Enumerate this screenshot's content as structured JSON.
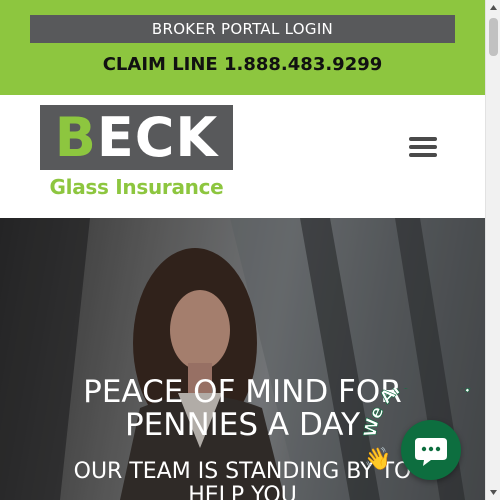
{
  "topbar": {
    "broker_login_label": "BROKER PORTAL LOGIN",
    "claim_line": "CLAIM LINE 1.888.483.9299"
  },
  "header": {
    "logo": {
      "letter_accent": "B",
      "letters_rest": "ECK",
      "subtitle": "Glass Insurance"
    },
    "menu_icon": "hamburger-menu-icon"
  },
  "hero": {
    "title_line1": "PEACE OF MIND FOR",
    "title_line2": "PENNIES A DAY",
    "subtitle_line1": "OUR TEAM IS STANDING BY TO",
    "subtitle_line2": "HELP YOU"
  },
  "chat": {
    "badge_text": "We Are Here!",
    "badge_emoji": "👋",
    "icon": "chat-bubble-icon"
  },
  "colors": {
    "brand_green": "#8dc63f",
    "brand_gray": "#58595b",
    "chat_green": "#0d6e3f"
  }
}
